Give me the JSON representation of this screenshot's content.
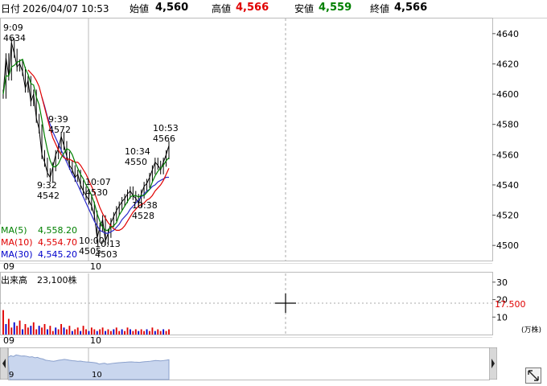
{
  "header": {
    "date_label": "日付",
    "date_value": "2026/04/07 10:53",
    "open_label": "始値",
    "open_value": "4,560",
    "high_label": "高値",
    "high_value": "4,566",
    "low_label": "安値",
    "low_value": "4,559",
    "close_label": "終値",
    "close_value": "4,566",
    "colors": {
      "high": "#e00000",
      "low": "#008000",
      "close": "#000000"
    }
  },
  "legend": [
    {
      "key": "MA(5)",
      "value": "4,558.20",
      "color": "#008000"
    },
    {
      "key": "MA(10)",
      "value": "4,554.70",
      "color": "#e00000"
    },
    {
      "key": "MA(30)",
      "value": "4,545.20",
      "color": "#0000cc"
    }
  ],
  "volume_panel": {
    "label": "出来高",
    "value": "23,100株",
    "crosshair_value": "17.500",
    "unit": "(万株)"
  },
  "chart_data": {
    "type": "line",
    "price": {
      "ylim": [
        4490,
        4650
      ],
      "yticks": [
        "4640",
        "4620",
        "4600",
        "4580",
        "4560",
        "4540",
        "4520",
        "4500"
      ],
      "xticks": [
        "09",
        "10"
      ],
      "close": [
        4600,
        4624,
        4612,
        4634,
        4627,
        4618,
        4620,
        4615,
        4604,
        4609,
        4595,
        4600,
        4584,
        4577,
        4560,
        4555,
        4548,
        4545,
        4552,
        4560,
        4564,
        4572,
        4566,
        4559,
        4553,
        4550,
        4545,
        4547,
        4540,
        4536,
        4533,
        4530,
        4526,
        4520,
        4505,
        4512,
        4517,
        4503,
        4508,
        4515,
        4519,
        4523,
        4526,
        4529,
        4531,
        4534,
        4536,
        4533,
        4531,
        4528,
        4534,
        4539,
        4541,
        4545,
        4550,
        4555,
        4553,
        4550,
        4555,
        4560,
        4566
      ],
      "ma5": [
        4600,
        4612,
        4612,
        4618,
        4619,
        4621,
        4622,
        4623,
        4617,
        4613,
        4607,
        4606,
        4598,
        4593,
        4583,
        4572,
        4563,
        4556,
        4552,
        4552,
        4554,
        4558,
        4561,
        4564,
        4563,
        4560,
        4555,
        4551,
        4547,
        4544,
        4540,
        4537,
        4533,
        4528,
        4521,
        4516,
        4512,
        4510,
        4510,
        4512,
        4513,
        4515,
        4520,
        4523,
        4526,
        4529,
        4532,
        4533,
        4533,
        4532,
        4533,
        4533,
        4535,
        4537,
        4542,
        4546,
        4549,
        4551,
        4553,
        4556,
        4558
      ],
      "ma10": [
        null,
        null,
        null,
        null,
        null,
        null,
        null,
        null,
        null,
        4616,
        4614,
        4612,
        4609,
        4605,
        4598,
        4591,
        4584,
        4577,
        4571,
        4567,
        4563,
        4560,
        4558,
        4557,
        4557,
        4556,
        4555,
        4555,
        4553,
        4550,
        4547,
        4543,
        4539,
        4535,
        4530,
        4525,
        4521,
        4518,
        4515,
        4513,
        4511,
        4510,
        4510,
        4511,
        4513,
        4516,
        4519,
        4522,
        4524,
        4526,
        4527,
        4528,
        4530,
        4531,
        4533,
        4536,
        4538,
        4540,
        4543,
        4547,
        4551
      ],
      "ma30": [
        null,
        null,
        null,
        null,
        null,
        null,
        null,
        null,
        null,
        null,
        null,
        null,
        null,
        null,
        4598,
        4592,
        4585,
        4580,
        4575,
        4571,
        4567,
        4563,
        4559,
        4555,
        4551,
        4547,
        4544,
        4540,
        4536,
        4532,
        4528,
        4524,
        4520,
        4516,
        4513,
        4510,
        4509,
        4508,
        4508,
        4509,
        4510,
        4512,
        4514,
        4517,
        4519,
        4521,
        4524,
        4526,
        4528,
        4530,
        4532,
        4534,
        4536,
        4537,
        4539,
        4540,
        4542,
        4543,
        4544,
        4545,
        4545
      ],
      "annotations": [
        {
          "time": "9:09",
          "price": "4634"
        },
        {
          "time": "9:39",
          "price": "4572"
        },
        {
          "time": "9:32",
          "price": "4542"
        },
        {
          "time": "10:07",
          "price": "4530"
        },
        {
          "time": "10:00",
          "price": "4505"
        },
        {
          "time": "10:13",
          "price": "4503"
        },
        {
          "time": "10:38",
          "price": "4528"
        },
        {
          "time": "10:34",
          "price": "4550"
        },
        {
          "time": "10:53",
          "price": "4566"
        }
      ]
    },
    "volume": {
      "ylim": [
        0,
        35
      ],
      "yticks": [
        "30",
        "20",
        "10"
      ],
      "xticks": [
        "09",
        "10"
      ],
      "values": [
        14,
        6,
        9,
        4,
        7,
        5,
        8,
        3,
        6,
        4,
        5,
        7,
        3,
        5,
        4,
        6,
        3,
        5,
        2,
        4,
        3,
        6,
        4,
        3,
        5,
        2,
        3,
        4,
        2,
        5,
        3,
        2,
        4,
        3,
        2,
        3,
        4,
        2,
        3,
        2,
        3,
        4,
        2,
        3,
        2,
        4,
        3,
        2,
        3,
        2,
        3,
        2,
        3,
        2,
        4,
        2,
        3,
        2,
        3,
        2,
        3
      ]
    },
    "navigator": {
      "xticks": [
        "9",
        "10"
      ]
    }
  }
}
